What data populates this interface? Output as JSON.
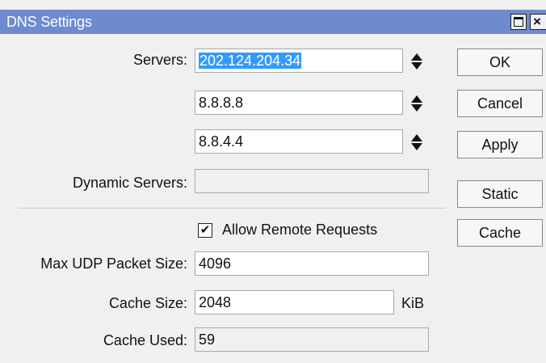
{
  "window": {
    "title": "DNS Settings",
    "close_glyph": "×"
  },
  "form": {
    "servers_label": "Servers:",
    "servers": [
      "202.124.204.34",
      "8.8.8.8",
      "8.8.4.4"
    ],
    "dynamic_servers_label": "Dynamic Servers:",
    "dynamic_servers_value": "",
    "allow_remote_requests": {
      "label": "Allow Remote Requests",
      "checked": true,
      "mark": "✔"
    },
    "max_udp_label": "Max UDP Packet Size:",
    "max_udp_value": "4096",
    "cache_size_label": "Cache Size:",
    "cache_size_value": "2048",
    "cache_size_unit": "KiB",
    "cache_used_label": "Cache Used:",
    "cache_used_value": "59"
  },
  "buttons": {
    "ok": "OK",
    "cancel": "Cancel",
    "apply": "Apply",
    "static": "Static",
    "cache": "Cache"
  },
  "colors": {
    "titlebar": "#6e8bd0",
    "selection": "#3399ff",
    "window_bg": "#f0f0f0"
  }
}
